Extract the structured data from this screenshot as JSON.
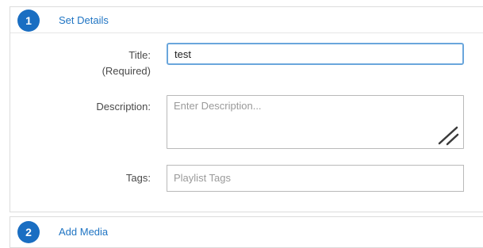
{
  "steps": [
    {
      "number": "1",
      "title": "Set Details"
    },
    {
      "number": "2",
      "title": "Add Media"
    }
  ],
  "form": {
    "title_label": "Title:",
    "title_required": "(Required)",
    "title_value": "test",
    "description_label": "Description:",
    "description_placeholder": "Enter Description...",
    "tags_label": "Tags:",
    "tags_placeholder": "Playlist Tags"
  },
  "icons": {
    "resize": "resize-handle-icon"
  },
  "colors": {
    "accent": "#1a6ec2",
    "link": "#1f74c3",
    "focus_border": "#6aa6dc",
    "border": "#b9b9b9"
  }
}
